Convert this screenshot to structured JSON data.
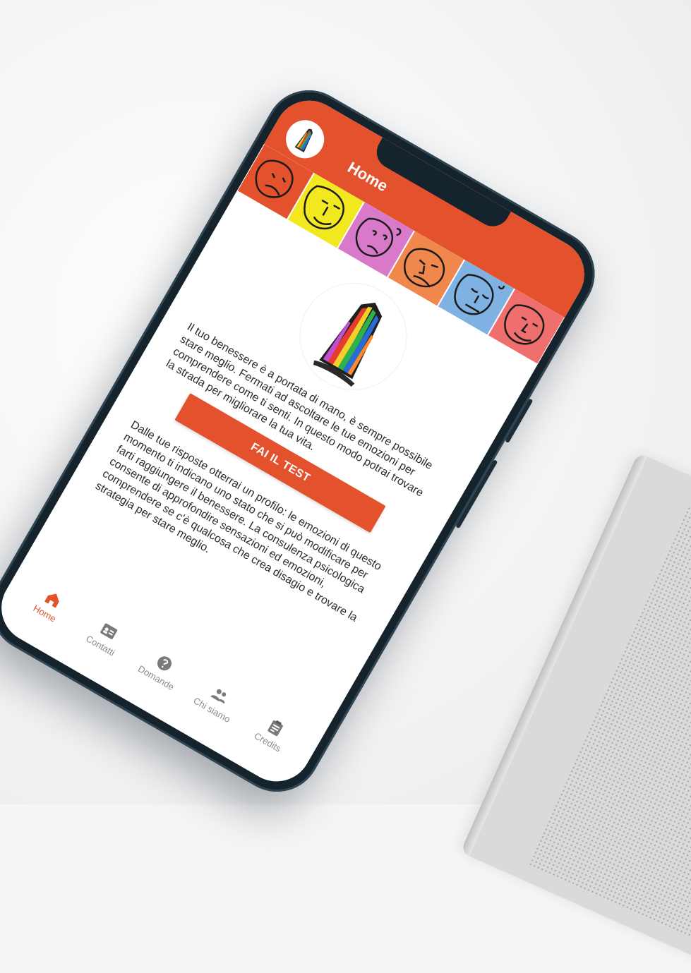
{
  "app": {
    "title": "Home",
    "accent_color": "#e4522d"
  },
  "main": {
    "intro_text": "Il tuo benessere è a portata di mano, è sempre possibile stare meglio. Fermati ad ascoltare le tue emozioni per comprendere come ti senti. In questo modo potrai trovare la strada per migliorare la tua vita.",
    "cta_label": "FAI IL TEST",
    "result_text": "Dalle tue risposte otterrai un profilo: le emozioni di questo momento ti indicano uno stato che si può modificare per farti raggiungere il benessere. La consulenza psicologica consente di approfondire sensazioni ed emozioni, comprendere se c'è qualcosa che crea disagio e trovare la strategia per stare meglio."
  },
  "banner": {
    "tiles": [
      {
        "color": "#e4522d",
        "icon": "face-drawing-icon"
      },
      {
        "color": "#f2e81f",
        "icon": "face-drawing-icon"
      },
      {
        "color": "#d979c9",
        "icon": "face-drawing-icon"
      },
      {
        "color": "#f0874d",
        "icon": "face-drawing-icon"
      },
      {
        "color": "#7fb2e3",
        "icon": "face-drawing-icon"
      },
      {
        "color": "#ef6e6e",
        "icon": "face-drawing-icon"
      }
    ]
  },
  "tabbar": {
    "items": [
      {
        "label": "Home",
        "icon": "home-icon",
        "active": true
      },
      {
        "label": "Contatti",
        "icon": "contacts-icon",
        "active": false
      },
      {
        "label": "Domande",
        "icon": "help-icon",
        "active": false
      },
      {
        "label": "Chi siamo",
        "icon": "people-icon",
        "active": false
      },
      {
        "label": "Credits",
        "icon": "clipboard-icon",
        "active": false
      }
    ]
  }
}
